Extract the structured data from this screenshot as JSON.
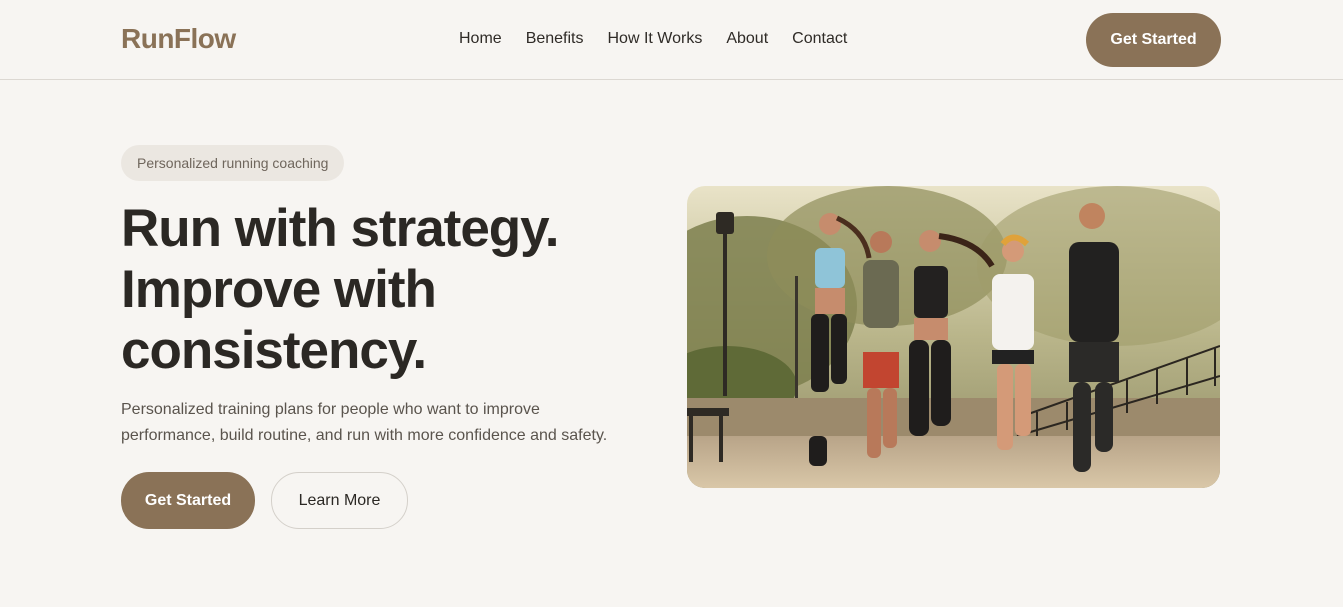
{
  "brand": {
    "logo": "RunFlow"
  },
  "nav": {
    "links": [
      "Home",
      "Benefits",
      "How It Works",
      "About",
      "Contact"
    ],
    "cta_label": "Get Started"
  },
  "hero": {
    "badge": "Personalized running coaching",
    "headline_lines": [
      "Run with strategy.",
      "Improve with",
      "consistency."
    ],
    "subtext_lines": [
      "Personalized training plans for people who want to improve",
      "performance, build routine, and run with more confidence and safety."
    ],
    "primary_cta": "Get Started",
    "secondary_cta": "Learn More"
  },
  "colors": {
    "background": "#f7f5f2",
    "accent": "#8a7257",
    "text_dark": "#2b2824",
    "text_muted": "#5a544d",
    "badge_bg": "#ebe7e1"
  }
}
